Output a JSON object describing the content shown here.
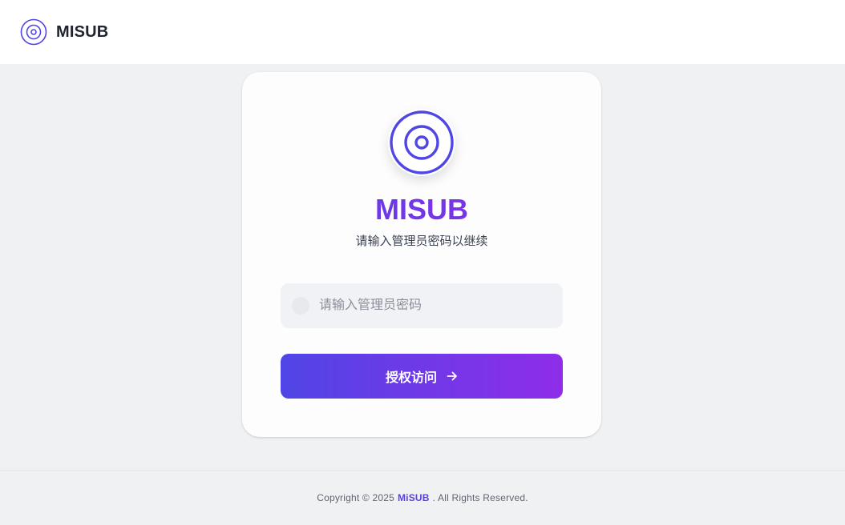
{
  "header": {
    "logo_icon": "target-logo-icon",
    "title": "MISUB"
  },
  "login": {
    "logo_icon": "target-logo-icon",
    "title": "MISUB",
    "subtitle": "请输入管理员密码以继续",
    "password": {
      "icon": "lock-icon",
      "placeholder": "请输入管理员密码",
      "value": ""
    },
    "submit_label": "授权访问",
    "submit_icon": "arrow-right-icon"
  },
  "footer": {
    "prefix": "Copyright © 2025",
    "brand": "MiSUB",
    "suffix": ". All Rights Reserved."
  },
  "colors": {
    "accent_start": "#5045e6",
    "accent_end": "#8f2de9",
    "logo_stroke": "#4f46e5",
    "page_bg": "#f0f1f3"
  }
}
